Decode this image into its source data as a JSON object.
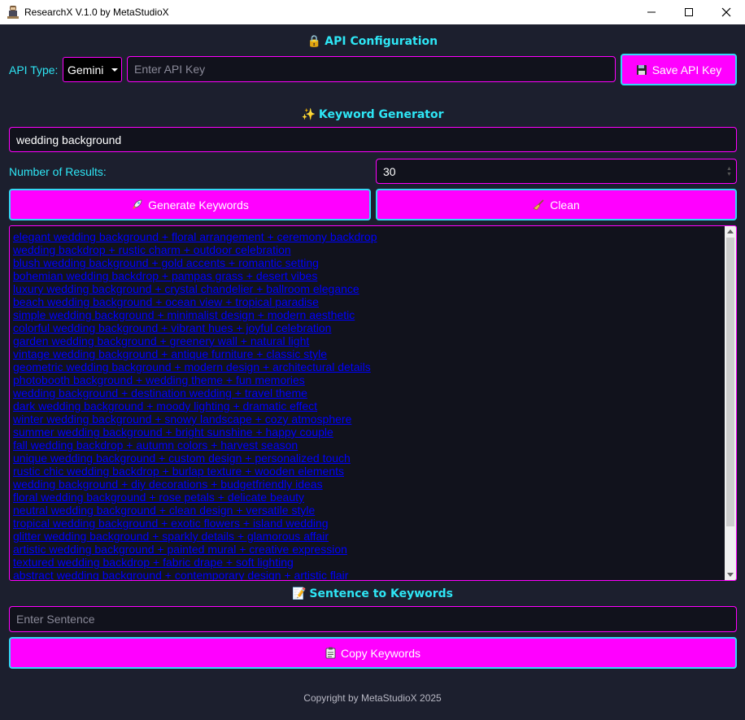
{
  "window": {
    "title": "ResearchX V.1.0 by MetaStudioX"
  },
  "api_section": {
    "emoji": "🔒",
    "title": "API Configuration",
    "type_label": "API Type:",
    "type_value": "Gemini",
    "key_placeholder": "Enter API Key",
    "save_label": "Save API Key"
  },
  "keyword_section": {
    "emoji": "✨",
    "title": "Keyword Generator",
    "query_value": "wedding background",
    "results_label": "Number of Results:",
    "results_count": "30",
    "generate_label": "Generate Keywords",
    "clean_label": "Clean"
  },
  "results": [
    "elegant wedding background + floral arrangement + ceremony backdrop",
    "wedding backdrop + rustic charm + outdoor celebration",
    "blush wedding background + gold accents + romantic setting",
    "bohemian wedding backdrop + pampas grass + desert vibes",
    "luxury wedding background + crystal chandelier + ballroom elegance",
    "beach wedding background + ocean view + tropical paradise",
    "simple wedding background + minimalist design + modern aesthetic",
    "colorful wedding background + vibrant hues + joyful celebration",
    "garden wedding background + greenery wall + natural light",
    "vintage wedding background + antique furniture + classic style",
    "geometric wedding background + modern design + architectural details",
    "photobooth background + wedding theme + fun memories",
    "wedding background + destination wedding + travel theme",
    "dark wedding background + moody lighting + dramatic effect",
    "winter wedding background + snowy landscape + cozy atmosphere",
    "summer wedding background + bright sunshine + happy couple",
    "fall wedding backdrop + autumn colors + harvest season",
    "unique wedding background + custom design + personalized touch",
    "rustic chic wedding backdrop + burlap texture + wooden elements",
    "wedding background + diy decorations + budgetfriendly ideas",
    "floral wedding background + rose petals + delicate beauty",
    "neutral wedding background + clean design + versatile style",
    "tropical wedding background + exotic flowers + island wedding",
    "glitter wedding background + sparkly details + glamorous affair",
    "artistic wedding background + painted mural + creative expression",
    "textured wedding backdrop + fabric drape + soft lighting",
    "abstract wedding background + contemporary design + artistic flair"
  ],
  "sentence_section": {
    "emoji": "📝",
    "title": "Sentence to Keywords",
    "placeholder": "Enter Sentence",
    "copy_label": "Copy Keywords"
  },
  "footer": "Copyright by MetaStudioX 2025",
  "colors": {
    "background": "#1c1f2e",
    "accent": "#ff00ff",
    "heading": "#2ee6f5",
    "link": "#0000ff"
  }
}
